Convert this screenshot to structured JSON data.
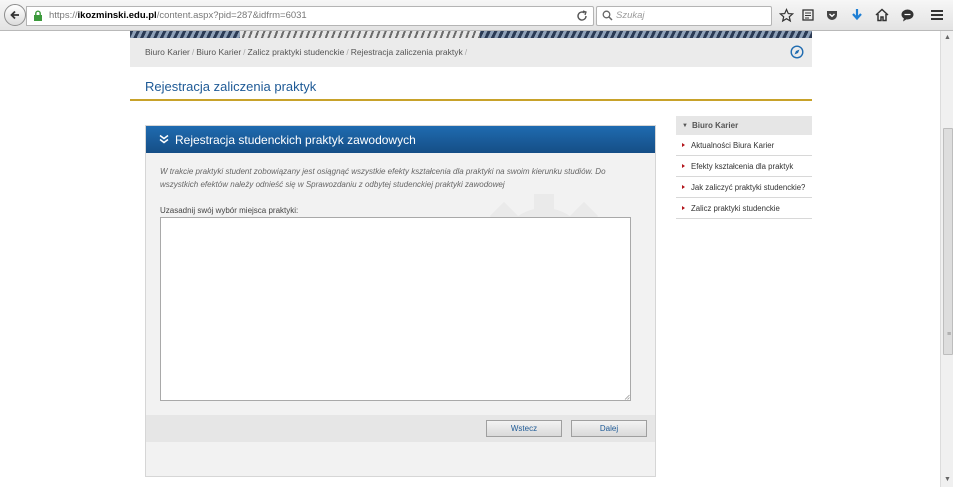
{
  "browser": {
    "url_scheme": "https://",
    "url_domain": "ikozminski.edu.pl",
    "url_path": "/content.aspx?pid=287&idfrm=6031",
    "search_placeholder": "Szukaj"
  },
  "breadcrumb": {
    "items": [
      "Biuro Karier",
      "Biuro Karier",
      "Zalicz praktyki studenckie",
      "Rejestracja zaliczenia praktyk"
    ],
    "separator": "/"
  },
  "page": {
    "title": "Rejestracja zaliczenia praktyk"
  },
  "form": {
    "header": "Rejestracja studenckich praktyk zawodowych",
    "intro": "W trakcie praktyki student zobowiązany jest osiągnąć wszystkie efekty kształcenia dla praktyki na swoim kierunku studiów. Do wszystkich efektów należy odnieść się w Sprawozdaniu z odbytej studenckiej praktyki zawodowej",
    "field_label": "Uzasadnij swój wybór miejsca praktyki:",
    "field_value": "",
    "back_label": "Wstecz",
    "next_label": "Dalej"
  },
  "sidebar": {
    "heading": "Biuro Karier",
    "items": [
      {
        "label": "Aktualności Biura Karier"
      },
      {
        "label": "Efekty kształcenia dla praktyk"
      },
      {
        "label": "Jak zaliczyć praktyki studenckie?"
      },
      {
        "label": "Zalicz praktyki studenckie"
      }
    ]
  },
  "colors": {
    "accent_blue": "#1e5a96",
    "header_blue": "#1f6bb0",
    "gold_rule": "#c8a22a",
    "bullet_red": "#b3151b"
  }
}
